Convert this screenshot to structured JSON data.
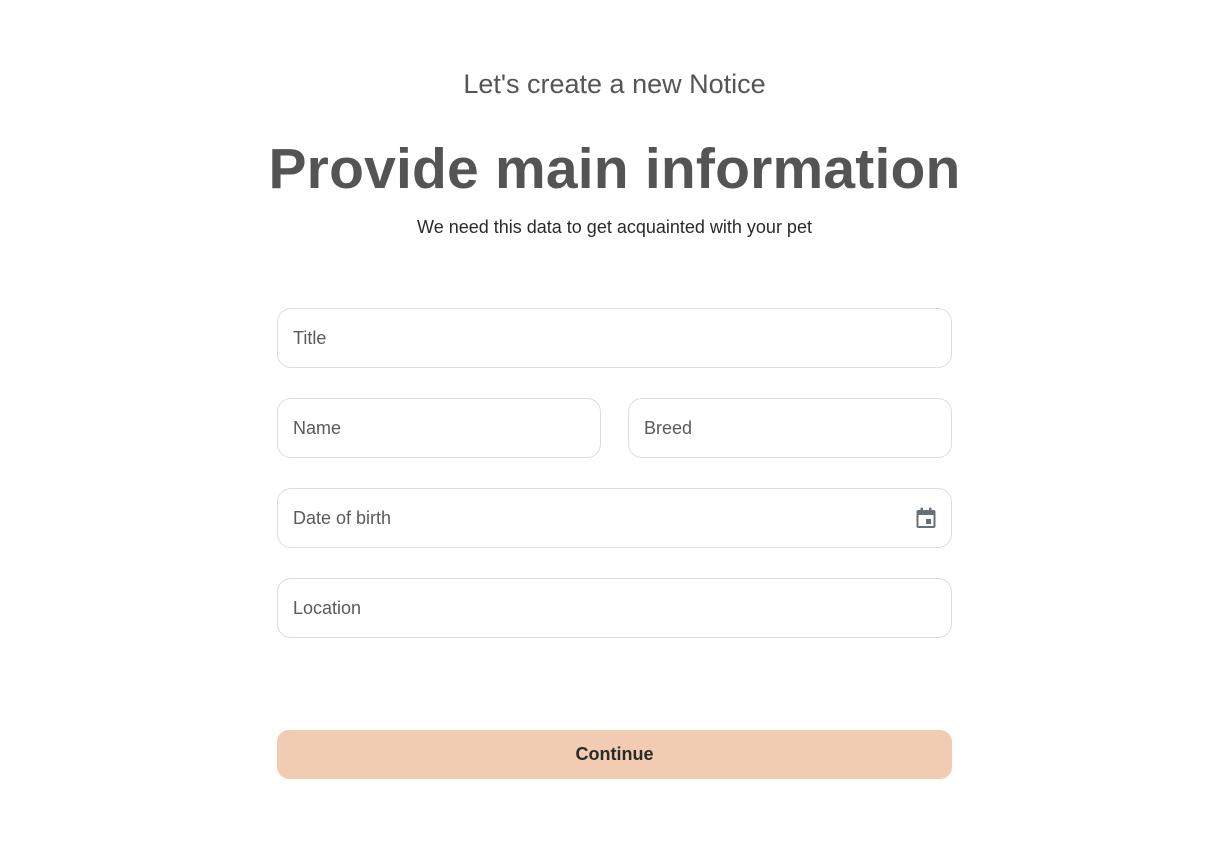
{
  "header": {
    "kicker": "Let's create a new Notice",
    "title": "Provide main information",
    "subtitle": "We need this data to get acquainted with your pet"
  },
  "form": {
    "title_placeholder": "Title",
    "name_placeholder": "Name",
    "breed_placeholder": "Breed",
    "dob_placeholder": "Date of birth",
    "location_placeholder": "Location",
    "dob_icon": "calendar-icon"
  },
  "actions": {
    "continue_label": "Continue"
  },
  "colors": {
    "button_bg": "#f1cbb2",
    "heading": "#545454",
    "field_border": "#dddddd",
    "icon": "#66707a"
  }
}
